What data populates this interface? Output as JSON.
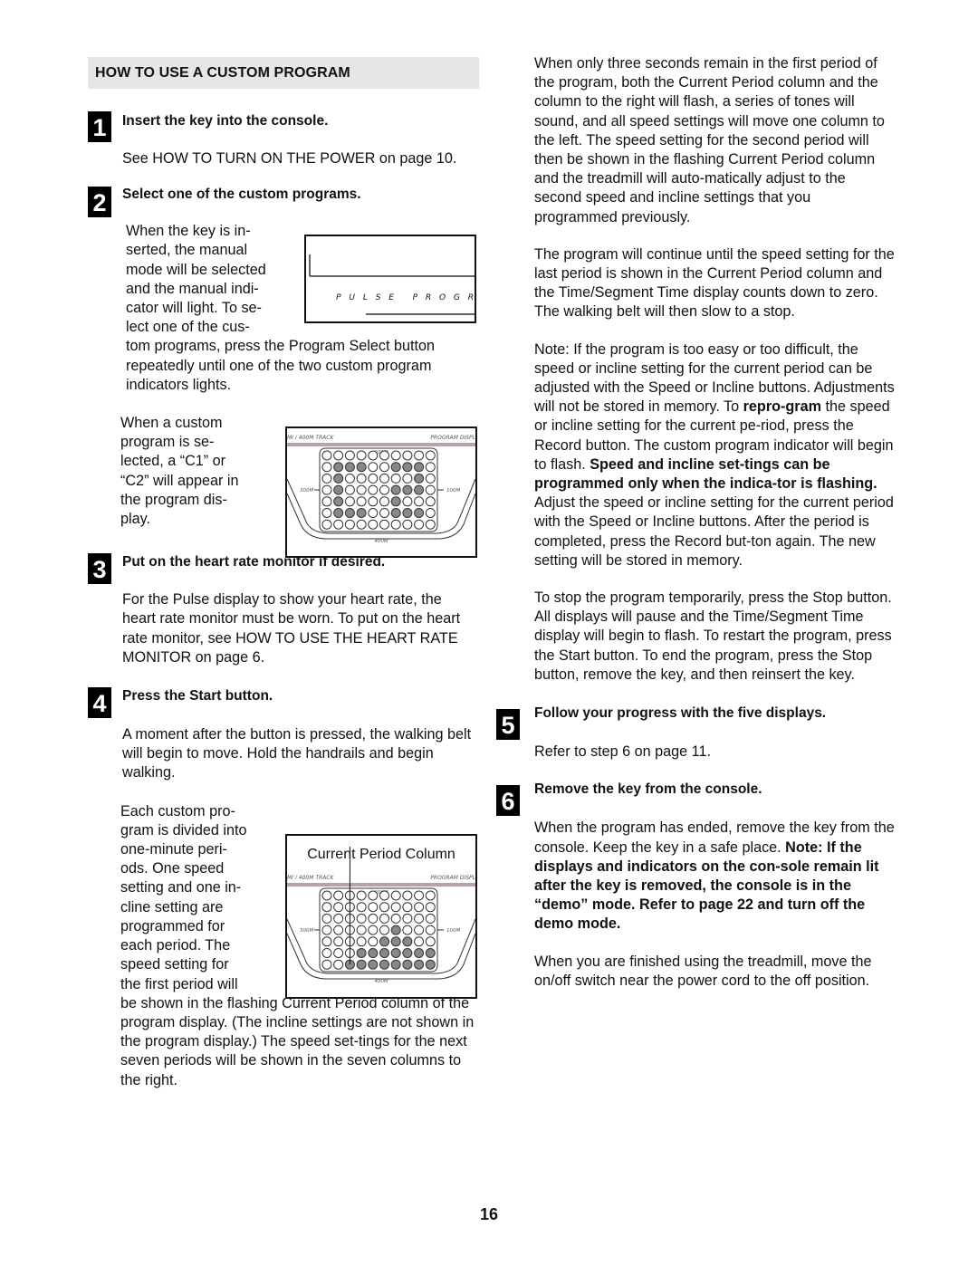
{
  "section": {
    "title": "HOW TO USE A CUSTOM PROGRAM"
  },
  "steps": [
    {
      "num": "1",
      "title": "Insert the key into the console.",
      "body": "See HOW TO TURN ON THE POWER on page 10."
    },
    {
      "num": "2",
      "title": "Select one of the custom programs.",
      "wrap_lines": [
        "When the key is in-",
        "serted, the manual",
        "mode will be selected",
        "and the manual indi-",
        "cator will light. To se-",
        "lect one of the cus-"
      ],
      "body_rest": "tom programs, press the Program Select button repeatedly until one of the two custom program indicators lights.",
      "wrap2_lines": [
        "When a custom",
        "program is se-",
        "lected, a “C1” or",
        "“C2” will appear in",
        "the program dis-",
        "play."
      ]
    },
    {
      "num": "3",
      "title": "Put on the heart rate monitor if desired.",
      "body": "For the Pulse display to show your heart rate, the heart rate monitor must be worn. To put on the heart rate monitor, see HOW TO USE THE HEART RATE MONITOR on page 6."
    },
    {
      "num": "4",
      "title": "Press the Start button.",
      "body": "A moment after the button is pressed, the walking belt will begin to move. Hold the handrails and begin walking.",
      "wrap_lines": [
        "Each custom pro-",
        "gram is divided into",
        "one-minute peri-",
        "ods. One speed",
        "setting and one in-",
        "cline setting are",
        "programmed for",
        "each period. The",
        "speed setting for",
        "the first period will"
      ],
      "body_rest": "be shown in the flashing Current Period column of the program display. (The incline settings are not shown in the program display.) The speed set-tings for the next seven periods will be shown in the seven columns to the right."
    },
    {
      "num": "5",
      "title": "Follow your progress with the five displays.",
      "body": "Refer to step 6 on page 11."
    },
    {
      "num": "6",
      "title": "Remove the key from the console.",
      "body_plain": "When the program has ended, remove the key from the console. Keep the key in a safe place.",
      "body_bold": "Note: If the displays and indicators on the con-sole remain lit after the key is removed, the console is in the “demo” mode. Refer to page 22 and turn off the demo mode.",
      "body2": "When you are finished using the treadmill, move the on/off switch near the power cord to the off position."
    }
  ],
  "right": {
    "p1": "When only three seconds remain in the first period of the program, both the Current Period column and the column to the right will flash, a series of tones will sound, and all speed settings will move one column to the left. The speed setting for the second period will then be shown in the flashing Current Period column and the treadmill will auto-matically adjust to the second speed and incline settings that you programmed previously.",
    "p2": "The program will continue until the speed setting for the last period is shown in the Current Period column and the Time/Segment Time display counts down to zero. The walking belt will then slow to a stop.",
    "p3_a": "Note: If the program is too easy or too difficult, the speed or incline setting for the current period can be adjusted with the Speed or Incline buttons. Adjustments will not be stored in memory. To ",
    "p3_b": "repro-gram",
    "p3_c": " the speed or incline setting for the current pe-riod, press the Record button. The custom program indicator will begin to flash. ",
    "p3_d": "Speed and incline set-tings can be programmed only when the indica-tor is flashing.",
    "p3_e": " Adjust the speed or incline setting for the current period with the Speed or Incline buttons. After the period is completed, press the Record but-ton again. The new setting will be stored in memory.",
    "p4": "To stop the program temporarily, press the Stop button. All displays will pause and the Time/Segment Time display will begin to flash. To restart the program, press the Start button. To end the program, press the Stop button, remove the key, and then reinsert the key."
  },
  "figures": {
    "console_label": "P U L S E   P R O G R",
    "track_left": "MI / 400M TRACK",
    "track_right": "PROGRAM DISPL",
    "m200": "200M",
    "m300": "300M",
    "m100": "100M",
    "m400": "400M",
    "current_period_label": "Current Period Column",
    "grid1_lit": [
      [
        1,
        1
      ],
      [
        1,
        2
      ],
      [
        1,
        3
      ],
      [
        1,
        6
      ],
      [
        1,
        7
      ],
      [
        1,
        8
      ],
      [
        2,
        1
      ],
      [
        2,
        8
      ],
      [
        3,
        1
      ],
      [
        3,
        6
      ],
      [
        3,
        7
      ],
      [
        3,
        8
      ],
      [
        4,
        1
      ],
      [
        4,
        6
      ],
      [
        5,
        1
      ],
      [
        5,
        2
      ],
      [
        5,
        3
      ],
      [
        5,
        6
      ],
      [
        5,
        7
      ],
      [
        5,
        8
      ]
    ],
    "grid2_lit": [
      [
        3,
        6
      ],
      [
        4,
        5
      ],
      [
        4,
        6
      ],
      [
        4,
        7
      ],
      [
        5,
        3
      ],
      [
        5,
        4
      ],
      [
        5,
        5
      ],
      [
        5,
        6
      ],
      [
        5,
        7
      ],
      [
        5,
        8
      ],
      [
        5,
        9
      ],
      [
        6,
        2
      ],
      [
        6,
        3
      ],
      [
        6,
        4
      ],
      [
        6,
        5
      ],
      [
        6,
        6
      ],
      [
        6,
        7
      ],
      [
        6,
        8
      ],
      [
        6,
        9
      ]
    ]
  },
  "page_number": "16"
}
